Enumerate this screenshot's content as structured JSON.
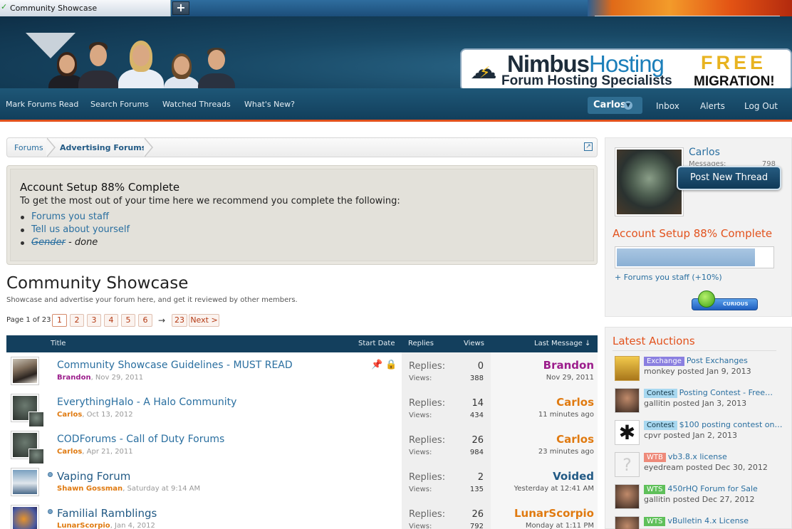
{
  "browser": {
    "tab_title": "Community Showcase",
    "new_tab_label": "+"
  },
  "ad": {
    "brand_part1": "Nimbus",
    "brand_part2": "Hosting",
    "tagline": "Forum Hosting Specialists",
    "free": "FREE",
    "migration": "MIGRATION!"
  },
  "nav": {
    "left": [
      "Mark Forums Read",
      "Search Forums",
      "Watched Threads",
      "What's New?"
    ],
    "user": "Carlos",
    "right": [
      "Inbox",
      "Alerts",
      "Log Out"
    ]
  },
  "breadcrumb": [
    "Forums",
    "Advertising Forums"
  ],
  "notice": {
    "title": "Account Setup 88% Complete",
    "desc": "To get the most out of your time here we recommend you complete the following:",
    "items": [
      {
        "label": "Forums you staff",
        "done": ""
      },
      {
        "label": "Tell us about yourself",
        "done": ""
      },
      {
        "label": "Gender",
        "done": " - done"
      }
    ]
  },
  "forum": {
    "title": "Community Showcase",
    "description": "Showcase and advertise your forum here, and get it reviewed by other members."
  },
  "pager": {
    "label": "Page 1 of 23",
    "pages": [
      "1",
      "2",
      "3",
      "4",
      "5",
      "6"
    ],
    "arrow": "→",
    "last": "23",
    "next": "Next >"
  },
  "table": {
    "headers": {
      "title": "Title",
      "start": "Start Date",
      "replies": "Replies",
      "views": "Views",
      "last": "Last Message ↓"
    },
    "replies_label": "Replies:",
    "views_label": "Views:",
    "rows": [
      {
        "title": "Community Showcase Guidelines - MUST READ",
        "author": "Brandon",
        "date": ", Nov 29, 2011",
        "replies": "0",
        "views": "388",
        "last_user": "Brandon",
        "last_time": "Nov 29, 2011",
        "author_color": "#9c1e8c",
        "icons": "📌 🔒"
      },
      {
        "title": "EverythingHalo - A Halo Community",
        "author": "Carlos",
        "date": ", Oct 13, 2012",
        "replies": "14",
        "views": "434",
        "last_user": "Carlos",
        "last_time": "11 minutes ago",
        "author_color": "#e07a10",
        "icons": ""
      },
      {
        "title": "CODForums - Call of Duty Forums",
        "author": "Carlos",
        "date": ", Apr 21, 2011",
        "replies": "26",
        "views": "984",
        "last_user": "Carlos",
        "last_time": "23 minutes ago",
        "author_color": "#e07a10",
        "icons": ""
      },
      {
        "title": "Vaping Forum",
        "author": "Shawn Gossman",
        "date": ", Saturday at 9:14 AM",
        "replies": "2",
        "views": "135",
        "last_user": "Voided",
        "last_time": "Yesterday at 12:41 AM",
        "author_color": "#e07a10",
        "last_color": "#225a85",
        "icons": ""
      },
      {
        "title": "Familial Ramblings",
        "author": "LunarScorpio",
        "date": ", Jan 4, 2012",
        "replies": "26",
        "views": "792",
        "last_user": "LunarScorpio",
        "last_time": "Monday at 1:11 PM",
        "author_color": "#e07a10",
        "icons": ""
      }
    ]
  },
  "visitor": {
    "name": "Carlos",
    "messages_label": "Messages:",
    "messages": "798",
    "post_button": "Post New Thread",
    "setup_title": "Account Setup 88% Complete",
    "setup_progress": 0.88,
    "hint": "+ Forums you staff (+10%)",
    "rank": "CURIOUS"
  },
  "auctions": {
    "title": "Latest Auctions",
    "items": [
      {
        "tag": "Exchange",
        "tag_bg": "#8a7fe0",
        "title": "Post Exchanges",
        "user": "monkey",
        "posted": " posted Jan 9, 2013"
      },
      {
        "tag": "Contest",
        "tag_bg": "#a8d8f0",
        "title": "Posting Contest - Free…",
        "user": "gallitin",
        "posted": " posted Jan 3, 2013"
      },
      {
        "tag": "Contest",
        "tag_bg": "#a8d8f0",
        "title": "$100 posting contest on…",
        "user": "cpvr",
        "posted": " posted Jan 2, 2013"
      },
      {
        "tag": "WTB",
        "tag_bg": "#ee8a7a",
        "title": "vb3.8.x license",
        "user": "eyedream",
        "posted": " posted Dec 30, 2012"
      },
      {
        "tag": "WTS",
        "tag_bg": "#5fc05a",
        "title": "450rHQ Forum for Sale",
        "user": "gallitin",
        "posted": " posted Dec 27, 2012"
      },
      {
        "tag": "WTS",
        "tag_bg": "#5fc05a",
        "title": "vBulletin 4.x License",
        "user": "",
        "posted": ""
      }
    ]
  }
}
